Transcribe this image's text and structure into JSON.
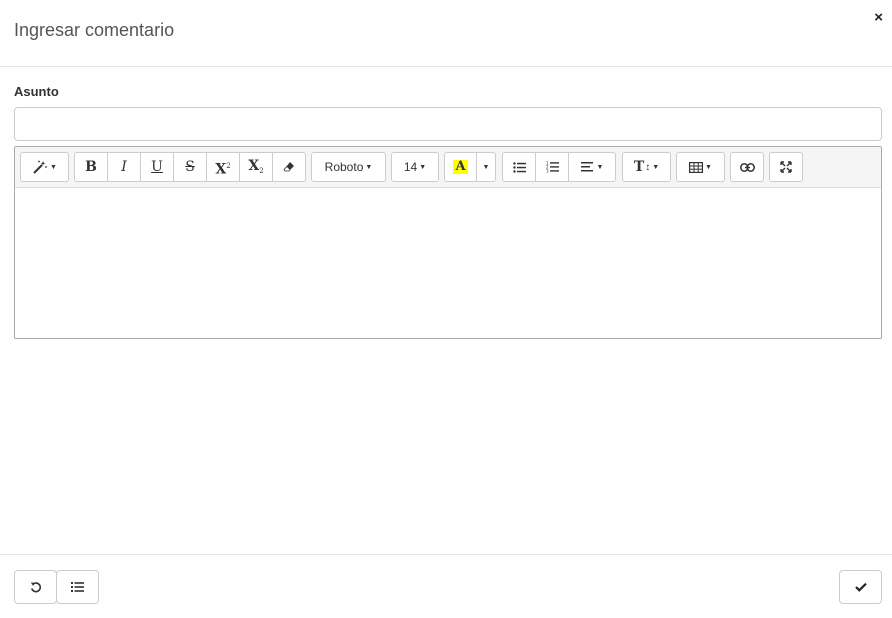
{
  "dialog": {
    "title": "Ingresar comentario",
    "close_glyph": "×"
  },
  "form": {
    "subject_label": "Asunto",
    "subject_value": ""
  },
  "toolbar": {
    "style_icon": "magic-wand-icon",
    "bold_label": "B",
    "italic_label": "I",
    "underline_label": "U",
    "strike_label": "S",
    "superscript_label": "X",
    "superscript_small": "2",
    "subscript_label": "X",
    "subscript_small": "2",
    "eraser_icon": "eraser-icon",
    "font_name": "Roboto",
    "font_size": "14",
    "highlight_letter": "A",
    "highlight_color": "#ffff00",
    "unordered_list_icon": "unordered-list-icon",
    "ordered_list_icon": "ordered-list-icon",
    "paragraph_icon": "align-left-icon",
    "line_height_label": "T",
    "table_icon": "table-icon",
    "link_icon": "link-icon",
    "fullscreen_icon": "fullscreen-icon"
  },
  "footer": {
    "reset_icon": "undo-icon",
    "list_icon": "list-icon",
    "confirm_icon": "check-icon"
  }
}
